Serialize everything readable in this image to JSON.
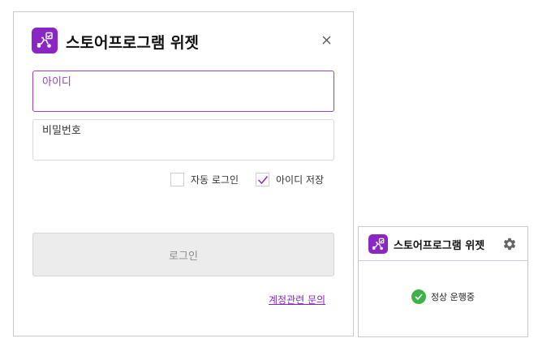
{
  "app_title": "스토어프로그램 위젯",
  "login": {
    "id_placeholder": "아이디",
    "password_placeholder": "비밀번호",
    "auto_login_label": "자동 로그인",
    "auto_login_checked": false,
    "save_id_label": "아이디 저장",
    "save_id_checked": true,
    "submit_label": "로그인",
    "inquiry_link": "계정관련 문의"
  },
  "status_widget": {
    "title": "스토어프로그램 위젯",
    "status_text": "정상 운행중",
    "status_icon": "check-circle-icon",
    "settings_icon": "gear-icon"
  },
  "colors": {
    "brand": "#8a26c4",
    "focus_border": "#9b3fc6",
    "ok": "#3db24a"
  }
}
